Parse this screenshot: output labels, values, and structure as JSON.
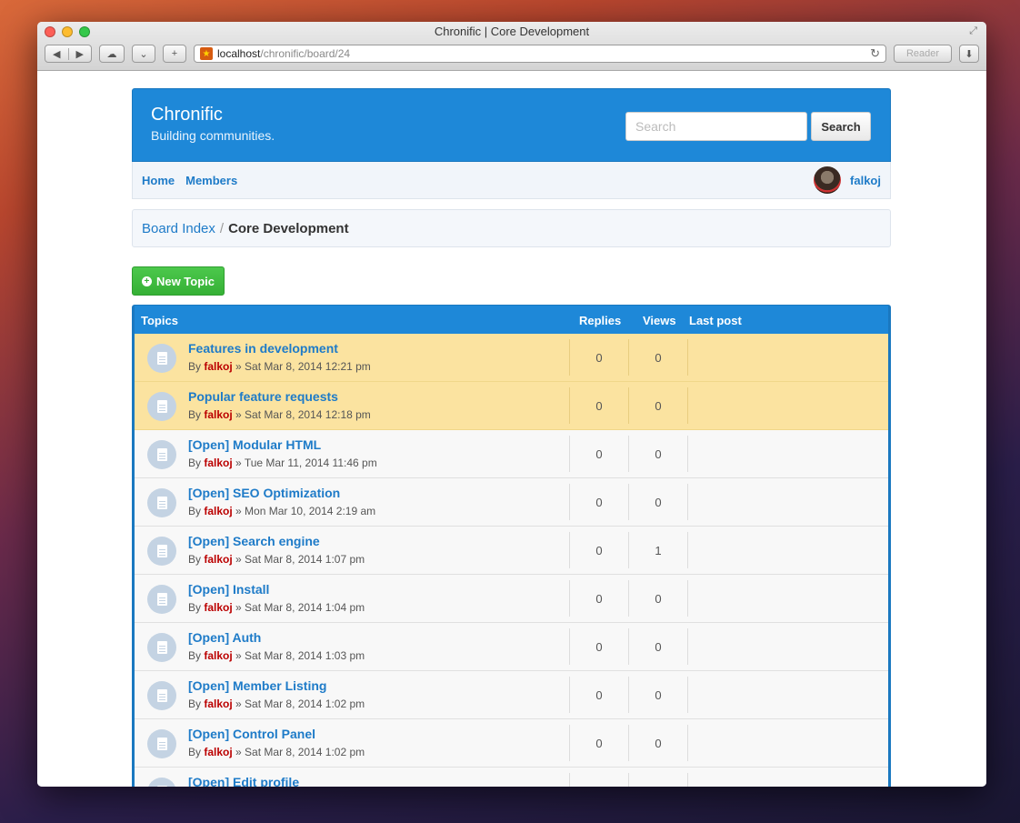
{
  "browser": {
    "window_title": "Chronific | Core Development",
    "url_host": "localhost",
    "url_path": "/chronific/board/24",
    "reader_label": "Reader"
  },
  "site": {
    "title": "Chronific",
    "subtitle": "Building communities.",
    "search_placeholder": "Search",
    "search_button": "Search"
  },
  "nav": {
    "items": [
      "Home",
      "Members"
    ],
    "username": "falkoj"
  },
  "breadcrumb": {
    "index": "Board Index",
    "separator": "/",
    "current": "Core Development"
  },
  "new_topic_label": "New Topic",
  "table": {
    "headers": {
      "topics": "Topics",
      "replies": "Replies",
      "views": "Views",
      "last_post": "Last post"
    },
    "rows": [
      {
        "title": "Features in development",
        "by": "By",
        "author": "falkoj",
        "date": "» Sat Mar 8, 2014 12:21 pm",
        "replies": "0",
        "views": "0",
        "sticky": true
      },
      {
        "title": "Popular feature requests",
        "by": "By",
        "author": "falkoj",
        "date": "» Sat Mar 8, 2014 12:18 pm",
        "replies": "0",
        "views": "0",
        "sticky": true
      },
      {
        "title": "[Open] Modular HTML",
        "by": "By",
        "author": "falkoj",
        "date": "» Tue Mar 11, 2014 11:46 pm",
        "replies": "0",
        "views": "0",
        "sticky": false
      },
      {
        "title": "[Open] SEO Optimization",
        "by": "By",
        "author": "falkoj",
        "date": "» Mon Mar 10, 2014 2:19 am",
        "replies": "0",
        "views": "0",
        "sticky": false
      },
      {
        "title": "[Open] Search engine",
        "by": "By",
        "author": "falkoj",
        "date": "» Sat Mar 8, 2014 1:07 pm",
        "replies": "0",
        "views": "1",
        "sticky": false
      },
      {
        "title": "[Open] Install",
        "by": "By",
        "author": "falkoj",
        "date": "» Sat Mar 8, 2014 1:04 pm",
        "replies": "0",
        "views": "0",
        "sticky": false
      },
      {
        "title": "[Open] Auth",
        "by": "By",
        "author": "falkoj",
        "date": "» Sat Mar 8, 2014 1:03 pm",
        "replies": "0",
        "views": "0",
        "sticky": false
      },
      {
        "title": "[Open] Member Listing",
        "by": "By",
        "author": "falkoj",
        "date": "» Sat Mar 8, 2014 1:02 pm",
        "replies": "0",
        "views": "0",
        "sticky": false
      },
      {
        "title": "[Open] Control Panel",
        "by": "By",
        "author": "falkoj",
        "date": "» Sat Mar 8, 2014 1:02 pm",
        "replies": "0",
        "views": "0",
        "sticky": false
      },
      {
        "title": "[Open] Edit profile",
        "by": "",
        "author": "",
        "date": "",
        "replies": "",
        "views": "",
        "sticky": false
      }
    ]
  },
  "colors": {
    "primary": "#1e88d8",
    "sticky_row": "#fbe3a0",
    "new_topic": "#35b035",
    "author": "#bb0000"
  }
}
